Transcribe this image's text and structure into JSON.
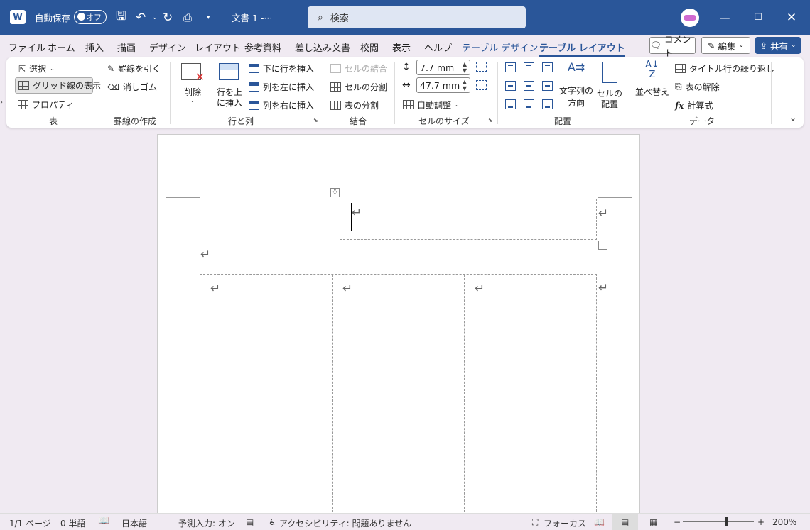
{
  "titlebar": {
    "app_icon": "word-icon",
    "autosave_label": "自動保存",
    "autosave_state": "オフ",
    "doc_title": "文書 1  -···",
    "search_placeholder": "検索"
  },
  "menu": {
    "tabs": [
      "ファイル",
      "ホーム",
      "挿入",
      "描画",
      "デザイン",
      "レイアウト",
      "参考資料",
      "差し込み文書",
      "校閲",
      "表示",
      "ヘルプ",
      "テーブル デザイン",
      "テーブル レイアウト"
    ],
    "active_tab": "テーブル レイアウト",
    "comment_label": "コメント",
    "edit_label": "編集",
    "share_label": "共有"
  },
  "ribbon": {
    "table": {
      "select": "選択",
      "gridlines": "グリッド線の表示",
      "properties": "プロパティ",
      "group_label": "表"
    },
    "draw": {
      "draw_table": "罫線を引く",
      "eraser": "消しゴム",
      "group_label": "罫線の作成"
    },
    "rows_cols": {
      "delete": "削除",
      "insert_above_1": "行を上",
      "insert_above_2": "に挿入",
      "insert_below": "下に行を挿入",
      "insert_left": "列を左に挿入",
      "insert_right": "列を右に挿入",
      "group_label": "行と列"
    },
    "merge": {
      "merge_cells": "セルの結合",
      "split_cells": "セルの分割",
      "split_table": "表の分割",
      "group_label": "結合"
    },
    "cell_size": {
      "height": "7.7 mm",
      "width": "47.7 mm",
      "autofit": "自動調整",
      "group_label": "セルのサイズ"
    },
    "alignment": {
      "text_direction_1": "文字列の",
      "text_direction_2": "方向",
      "cell_margins_1": "セルの",
      "cell_margins_2": "配置",
      "group_label": "配置"
    },
    "data": {
      "sort": "並べ替え",
      "repeat_header": "タイトル行の繰り返し",
      "convert_to_text": "表の解除",
      "formula": "計算式",
      "group_label": "データ"
    }
  },
  "document": {
    "para_mark": "↵"
  },
  "statusbar": {
    "page": "1/1 ページ",
    "words": "0 単語",
    "language": "日本語",
    "predictive": "予測入力: オン",
    "accessibility": "アクセシビリティ: 問題ありません",
    "focus": "フォーカス",
    "zoom": "200%"
  }
}
